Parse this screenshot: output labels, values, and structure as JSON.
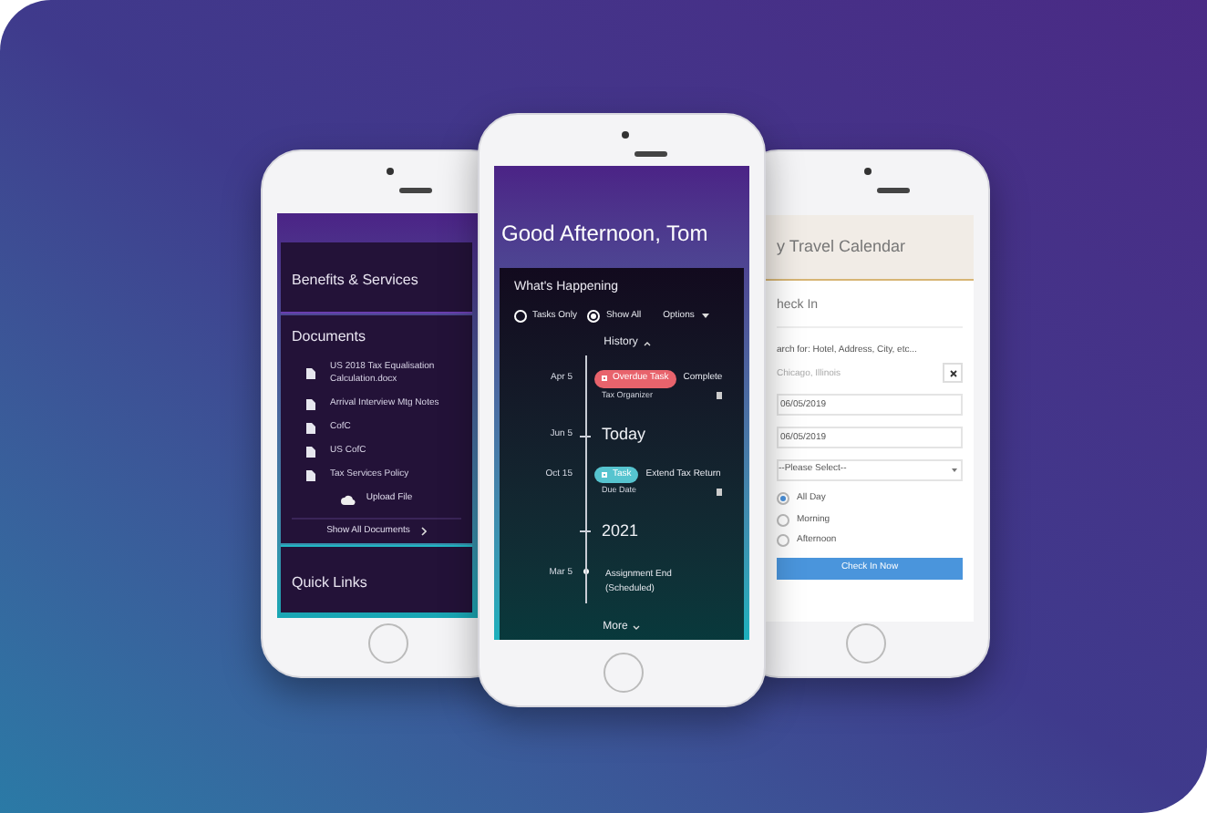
{
  "left_phone": {
    "benefits": "Benefits & Services",
    "documents_title": "Documents",
    "files": [
      "US 2018 Tax Equalisation Calculation.docx",
      "Arrival Interview Mtg Notes",
      "CofC",
      "US CofC",
      "Tax Services Policy"
    ],
    "upload": "Upload File",
    "show_all": "Show All Documents",
    "quick_links": "Quick Links"
  },
  "center_phone": {
    "greeting": "Good Afternoon, Tom",
    "card_title": "What's Happening",
    "filters": [
      {
        "label": "Tasks Only",
        "selected": false
      },
      {
        "label": "Show All",
        "selected": true
      }
    ],
    "options": "Options",
    "history": "History",
    "timeline": [
      {
        "kind": "task",
        "date": "Apr 5",
        "tag": "Overdue Task",
        "color": "#e8636c",
        "title": "Complete",
        "subtitle": "Tax Organizer"
      },
      {
        "kind": "heading",
        "date": "Jun 5",
        "label": "Today"
      },
      {
        "kind": "task",
        "date": "Oct 15",
        "tag": "Task",
        "color": "#56c4cf",
        "title": "Extend Tax Return",
        "subtitle": "Due Date"
      },
      {
        "kind": "heading",
        "label": "2021"
      },
      {
        "kind": "event",
        "date": "Mar 5",
        "title": "Assignment End",
        "subtitle": "(Scheduled)"
      }
    ],
    "more": "More"
  },
  "right_phone": {
    "header": "y Travel Calendar",
    "section": "heck In",
    "search_label": "arch for: Hotel, Address, City, etc...",
    "search_placeholder": "Chicago, Illinois",
    "dates": [
      "06/05/2019",
      "06/05/2019"
    ],
    "select": "--Please Select--",
    "times": [
      {
        "label": "All Day",
        "selected": true
      },
      {
        "label": "Morning",
        "selected": false
      },
      {
        "label": "Afternoon",
        "selected": false
      }
    ],
    "button": "Check In Now"
  }
}
